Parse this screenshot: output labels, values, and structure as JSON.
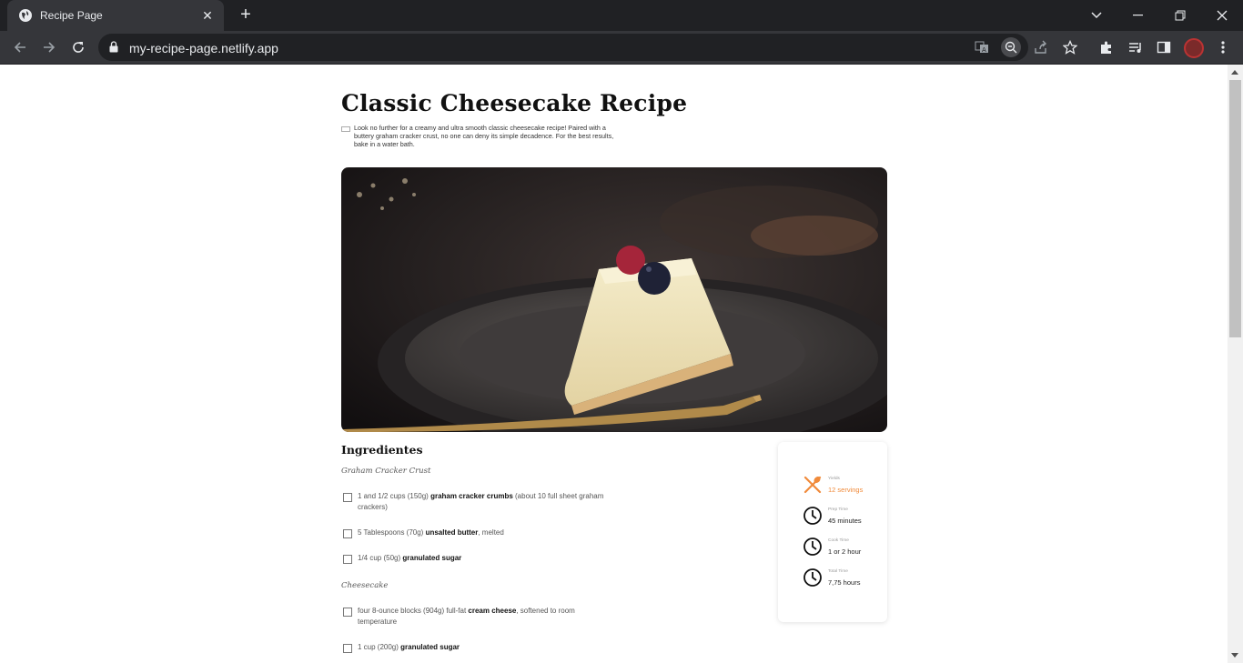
{
  "browser": {
    "tab_title": "Recipe Page",
    "url": "my-recipe-page.netlify.app",
    "new_tab": "+",
    "tab_close": "✕"
  },
  "recipe": {
    "title": "Classic Cheesecake Recipe",
    "intro": "Look no further for a creamy and ultra smooth classic cheesecake recipe! Paired with a buttery graham cracker crust, no one can deny its simple decadence. For the best results, bake in a water bath.",
    "ingredients_title": "Ingredientes",
    "sections": [
      {
        "name": "Graham Cracker Crust",
        "items": [
          {
            "pre": "1 and 1/2 cups (150g) ",
            "bold": "graham cracker crumbs",
            "post": " (about 10 full sheet graham crackers)"
          },
          {
            "pre": "5 Tablespoons (70g) ",
            "bold": "unsalted butter",
            "post": ", melted"
          },
          {
            "pre": "1/4 cup (50g) ",
            "bold": "granulated sugar",
            "post": ""
          }
        ]
      },
      {
        "name": "Cheesecake",
        "items": [
          {
            "pre": "four 8-ounce blocks (904g) full-fat ",
            "bold": "cream cheese",
            "post": ", softened to room temperature"
          },
          {
            "pre": "1 cup (200g) ",
            "bold": "granulated sugar",
            "post": ""
          }
        ]
      }
    ],
    "stats": [
      {
        "label": "Yields",
        "value": "12 servings",
        "icon": "utensils-icon"
      },
      {
        "label": "Prep Time",
        "value": "45 minutes",
        "icon": "clock-icon"
      },
      {
        "label": "Cook Time",
        "value": "1 or 2 hour",
        "icon": "clock-icon"
      },
      {
        "label": "Total Time",
        "value": "7,75 hours",
        "icon": "clock-icon"
      }
    ]
  },
  "colors": {
    "accent": "#f08a3a",
    "chrome_dark": "#202124",
    "chrome_mid": "#35363a"
  }
}
